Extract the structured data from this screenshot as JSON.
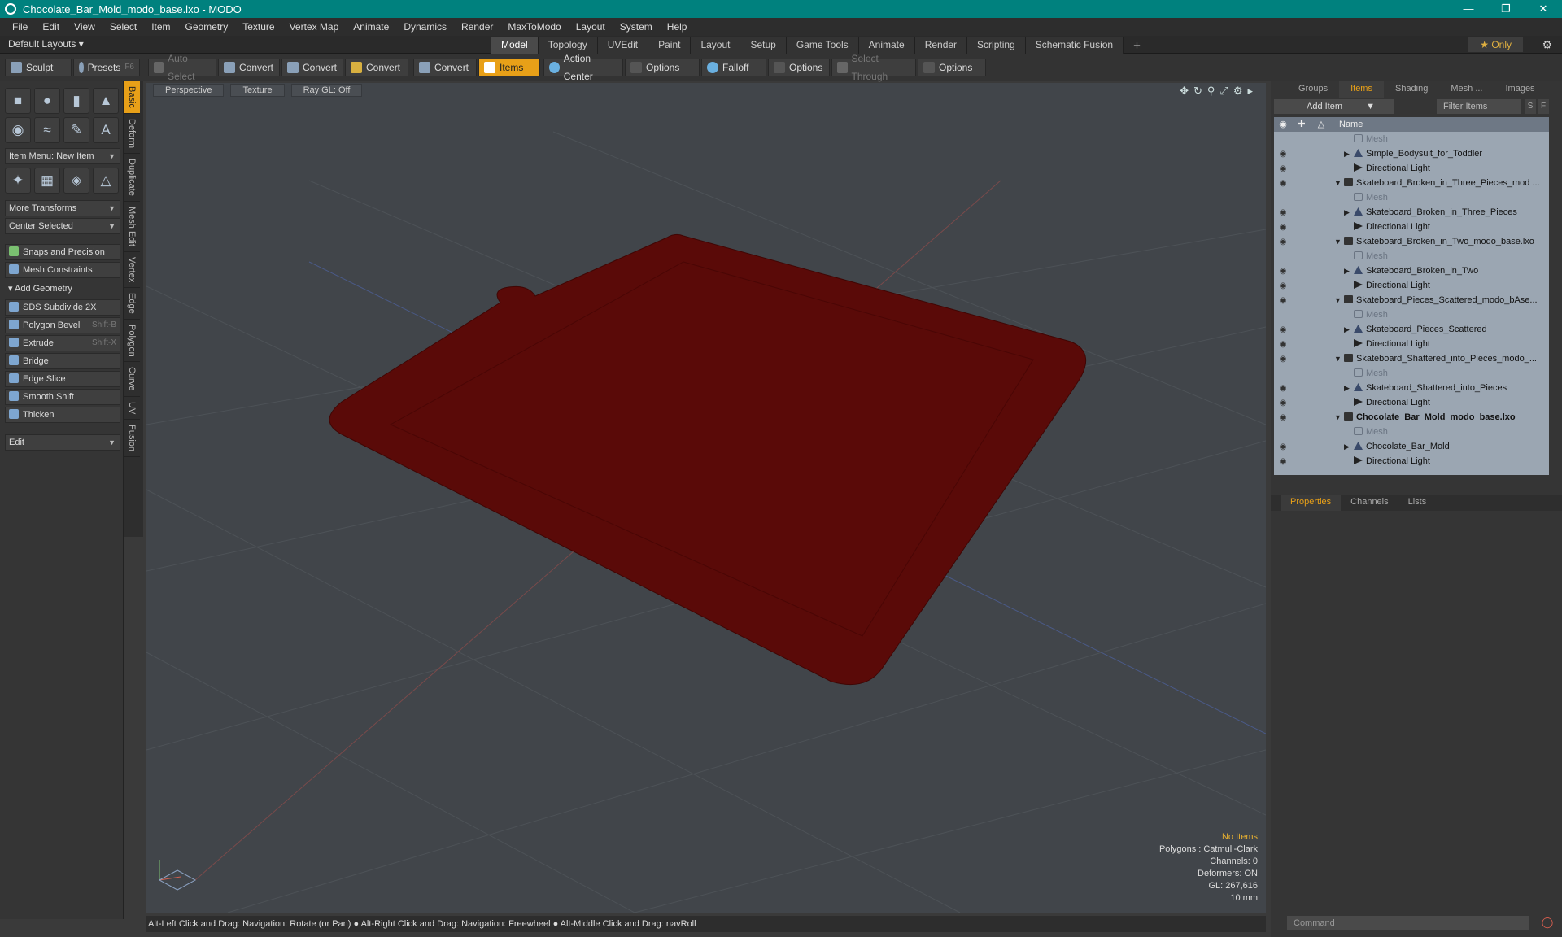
{
  "window": {
    "title": "Chocolate_Bar_Mold_modo_base.lxo - MODO"
  },
  "menu": [
    "File",
    "Edit",
    "View",
    "Select",
    "Item",
    "Geometry",
    "Texture",
    "Vertex Map",
    "Animate",
    "Dynamics",
    "Render",
    "MaxToModo",
    "Layout",
    "System",
    "Help"
  ],
  "layout": {
    "default_layouts": "Default Layouts",
    "tabs": [
      "Model",
      "Topology",
      "UVEdit",
      "Paint",
      "Layout",
      "Setup",
      "Game Tools",
      "Animate",
      "Render",
      "Scripting",
      "Schematic Fusion"
    ],
    "active_tab": "Model",
    "only": "Only"
  },
  "toolbar": {
    "sculpt": "Sculpt",
    "presets": "Presets",
    "presets_key": "F6",
    "auto_select": "Auto Select",
    "convert1": "Convert",
    "convert2": "Convert",
    "convert3": "Convert",
    "convert4": "Convert",
    "items": "Items",
    "action_center": "Action Center",
    "options1": "Options",
    "falloff": "Falloff",
    "options2": "Options",
    "select_through": "Select Through",
    "options3": "Options"
  },
  "leftpanel": {
    "item_menu": "Item Menu: New Item",
    "more_transforms": "More Transforms",
    "center_selected": "Center Selected",
    "snaps": "Snaps and Precision",
    "mesh_constraints": "Mesh Constraints",
    "add_geometry": "Add Geometry",
    "tools": [
      {
        "label": "SDS Subdivide 2X",
        "shortcut": ""
      },
      {
        "label": "Polygon Bevel",
        "shortcut": "Shift-B"
      },
      {
        "label": "Extrude",
        "shortcut": "Shift-X"
      },
      {
        "label": "Bridge",
        "shortcut": ""
      },
      {
        "label": "Edge Slice",
        "shortcut": ""
      },
      {
        "label": "Smooth Shift",
        "shortcut": ""
      },
      {
        "label": "Thicken",
        "shortcut": ""
      }
    ],
    "edit": "Edit",
    "vtabs": [
      "Basic",
      "Deform",
      "Duplicate",
      "Mesh Edit",
      "Vertex",
      "Edge",
      "Polygon",
      "Curve",
      "UV",
      "Fusion"
    ]
  },
  "viewport": {
    "view": "Perspective",
    "shading": "Texture",
    "raygl": "Ray GL: Off",
    "info": {
      "no_items": "No Items",
      "polygons": "Polygons : Catmull-Clark",
      "channels": "Channels: 0",
      "deformers": "Deformers: ON",
      "gl": "GL: 267,616",
      "scale": "10 mm"
    },
    "mold_color": "#5a0a08"
  },
  "statusbar": "Alt-Left Click and Drag: Navigation: Rotate (or Pan) ●  Alt-Right Click and Drag: Navigation: Freewheel ●  Alt-Middle Click and Drag: navRoll",
  "rightpanel": {
    "tabs": [
      "Groups",
      "Items",
      "Shading",
      "Mesh ...",
      "Images"
    ],
    "active_tab": "Items",
    "add_item": "Add Item",
    "filter": "Filter Items",
    "s": "S",
    "f": "F",
    "col_name": "Name",
    "tree": [
      {
        "name": "Mesh",
        "type": "mesh",
        "indent": 2,
        "dim": true,
        "bold": false,
        "tri": ""
      },
      {
        "name": "Simple_Bodysuit_for_Toddler",
        "type": "loc",
        "indent": 2,
        "dim": false,
        "bold": false,
        "tri": "▶"
      },
      {
        "name": "Directional Light",
        "type": "light",
        "indent": 2,
        "dim": false,
        "bold": false,
        "tri": ""
      },
      {
        "name": "Skateboard_Broken_in_Three_Pieces_mod ...",
        "type": "scene",
        "indent": 1,
        "dim": false,
        "bold": false,
        "tri": "▼"
      },
      {
        "name": "Mesh",
        "type": "mesh",
        "indent": 2,
        "dim": true,
        "bold": false,
        "tri": ""
      },
      {
        "name": "Skateboard_Broken_in_Three_Pieces",
        "type": "loc",
        "indent": 2,
        "dim": false,
        "bold": false,
        "tri": "▶"
      },
      {
        "name": "Directional Light",
        "type": "light",
        "indent": 2,
        "dim": false,
        "bold": false,
        "tri": ""
      },
      {
        "name": "Skateboard_Broken_in_Two_modo_base.lxo",
        "type": "scene",
        "indent": 1,
        "dim": false,
        "bold": false,
        "tri": "▼"
      },
      {
        "name": "Mesh",
        "type": "mesh",
        "indent": 2,
        "dim": true,
        "bold": false,
        "tri": ""
      },
      {
        "name": "Skateboard_Broken_in_Two",
        "type": "loc",
        "indent": 2,
        "dim": false,
        "bold": false,
        "tri": "▶"
      },
      {
        "name": "Directional Light",
        "type": "light",
        "indent": 2,
        "dim": false,
        "bold": false,
        "tri": ""
      },
      {
        "name": "Skateboard_Pieces_Scattered_modo_bAse...",
        "type": "scene",
        "indent": 1,
        "dim": false,
        "bold": false,
        "tri": "▼"
      },
      {
        "name": "Mesh",
        "type": "mesh",
        "indent": 2,
        "dim": true,
        "bold": false,
        "tri": ""
      },
      {
        "name": "Skateboard_Pieces_Scattered",
        "type": "loc",
        "indent": 2,
        "dim": false,
        "bold": false,
        "tri": "▶"
      },
      {
        "name": "Directional Light",
        "type": "light",
        "indent": 2,
        "dim": false,
        "bold": false,
        "tri": ""
      },
      {
        "name": "Skateboard_Shattered_into_Pieces_modo_...",
        "type": "scene",
        "indent": 1,
        "dim": false,
        "bold": false,
        "tri": "▼"
      },
      {
        "name": "Mesh",
        "type": "mesh",
        "indent": 2,
        "dim": true,
        "bold": false,
        "tri": ""
      },
      {
        "name": "Skateboard_Shattered_into_Pieces",
        "type": "loc",
        "indent": 2,
        "dim": false,
        "bold": false,
        "tri": "▶"
      },
      {
        "name": "Directional Light",
        "type": "light",
        "indent": 2,
        "dim": false,
        "bold": false,
        "tri": ""
      },
      {
        "name": "Chocolate_Bar_Mold_modo_base.lxo",
        "type": "scene",
        "indent": 1,
        "dim": false,
        "bold": true,
        "tri": "▼"
      },
      {
        "name": "Mesh",
        "type": "mesh",
        "indent": 2,
        "dim": true,
        "bold": false,
        "tri": ""
      },
      {
        "name": "Chocolate_Bar_Mold",
        "type": "loc",
        "indent": 2,
        "dim": false,
        "bold": false,
        "tri": "▶"
      },
      {
        "name": "Directional Light",
        "type": "light",
        "indent": 2,
        "dim": false,
        "bold": false,
        "tri": ""
      }
    ],
    "props_tabs": [
      "Properties",
      "Channels",
      "Lists"
    ],
    "props_active": "Properties",
    "command": "Command"
  }
}
